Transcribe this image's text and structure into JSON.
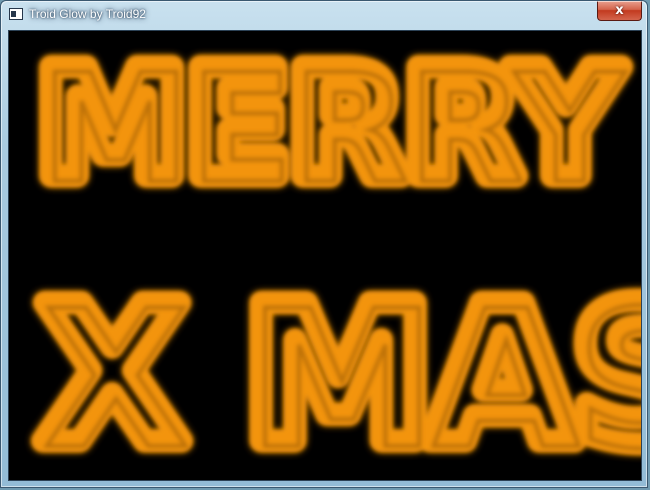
{
  "window": {
    "title": "Troid Glow by Troid92",
    "close_label": "x"
  },
  "canvas": {
    "background": "#000000",
    "glow_color": "#f39408",
    "shadow_color": "#3a2000",
    "lines": [
      "MERRY",
      "X MAS"
    ]
  }
}
